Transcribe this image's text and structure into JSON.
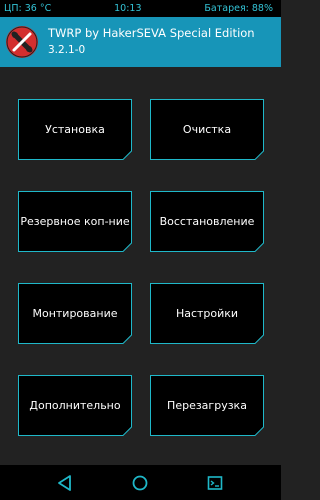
{
  "status_bar": {
    "cpu": "ЦП: 36 °C",
    "time": "10:13",
    "battery": "Батарея: 88%"
  },
  "header": {
    "title": "TWRP by HakerSEVA Special Edition",
    "version": "3.2.1-0",
    "logo_icon": "twrp-logo-icon"
  },
  "menu": [
    {
      "label": "Установка"
    },
    {
      "label": "Очистка"
    },
    {
      "label": "Резервное коп-ние"
    },
    {
      "label": "Восстановление"
    },
    {
      "label": "Монтирование"
    },
    {
      "label": "Настройки"
    },
    {
      "label": "Дополнительно"
    },
    {
      "label": "Перезагрузка"
    }
  ],
  "nav": {
    "back_icon": "back-triangle-icon",
    "home_icon": "home-icon",
    "log_icon": "terminal-log-icon"
  },
  "colors": {
    "accent": "#1795b8",
    "button_border": "#1fb8c9",
    "status_text": "#33c3d6",
    "background": "#222222"
  }
}
